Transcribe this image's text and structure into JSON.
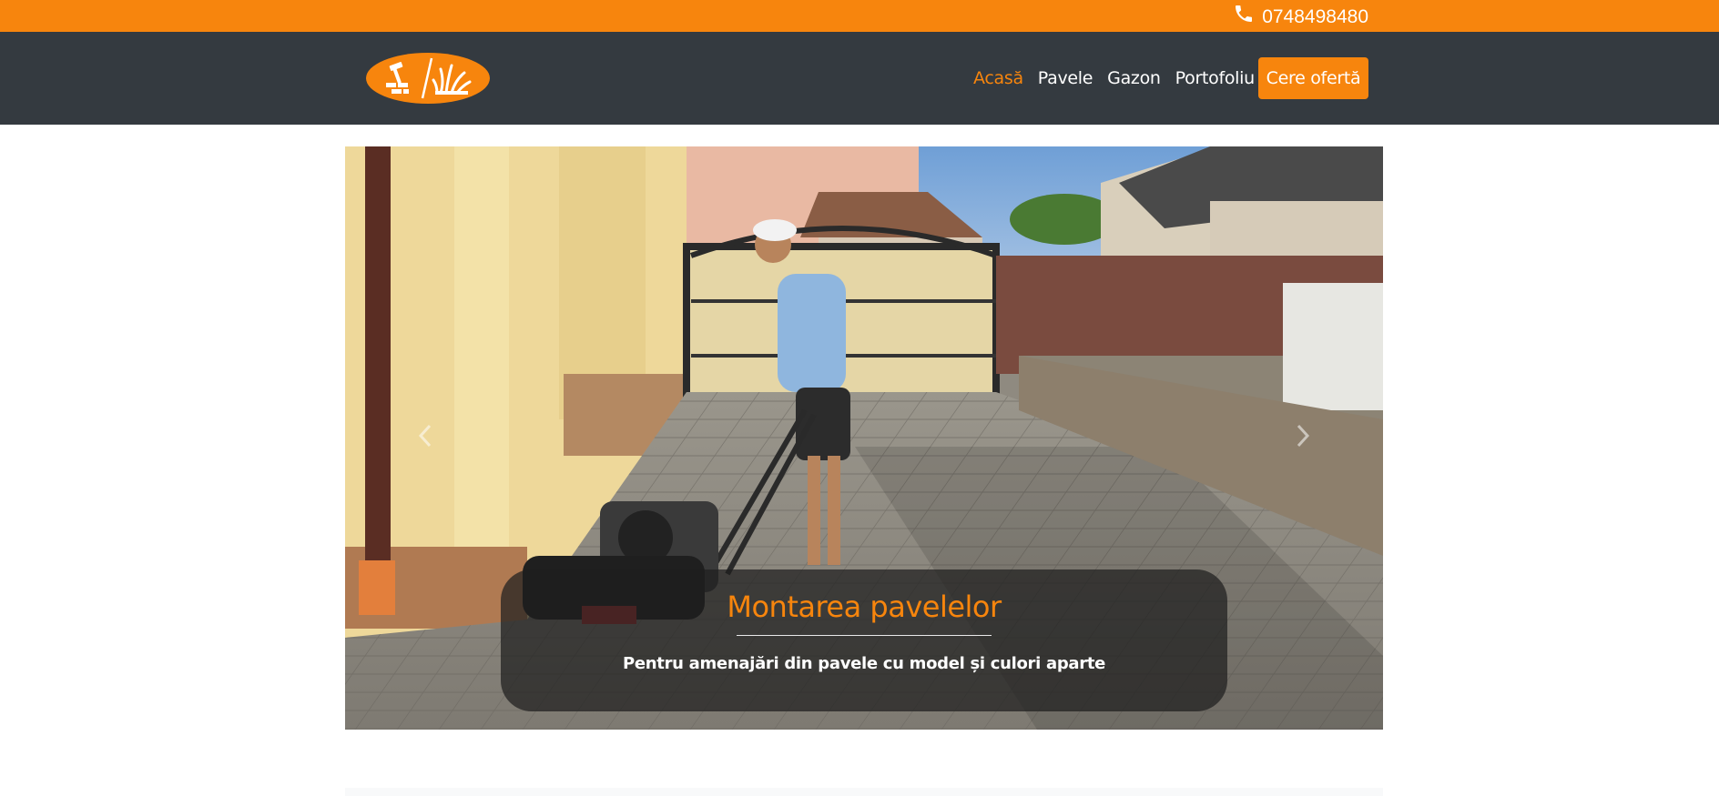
{
  "topbar": {
    "phone": "0748498480",
    "phone_icon": "phone-icon",
    "background": "#f7850d"
  },
  "navbar": {
    "background": "#343a40",
    "logo_icon": "hammer-bricks-grass-logo",
    "items": [
      {
        "label": "Acasă",
        "active": true
      },
      {
        "label": "Pavele",
        "active": false
      },
      {
        "label": "Gazon",
        "active": false
      },
      {
        "label": "Portofoliu",
        "active": false
      }
    ],
    "cta_label": "Cere ofertă"
  },
  "carousel": {
    "prev_icon": "chevron-left-icon",
    "next_icon": "chevron-right-icon",
    "slide": {
      "title": "Montarea pavelelor",
      "subtitle": "Pentru amenajări din pavele cu model și culori aparte"
    }
  },
  "colors": {
    "accent": "#f7850d",
    "dark": "#343a40"
  }
}
